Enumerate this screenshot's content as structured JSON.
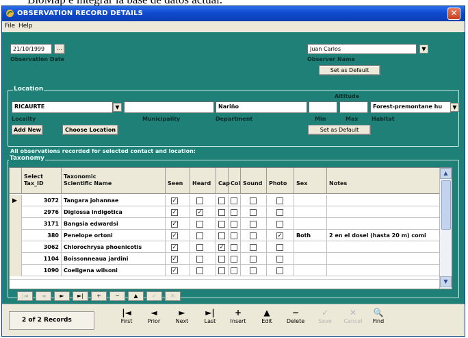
{
  "background_text": "BioMap e integrar la base de datos actual.",
  "window": {
    "title": "OBSERVATION RECORD DETAILS",
    "close_glyph": "✕"
  },
  "menu": [
    "File",
    "Help"
  ],
  "observation": {
    "date_value": "21/10/1999",
    "date_btn": "...",
    "date_label": "Observation Date",
    "observer_value": "Juan Carlos",
    "observer_label": "Observer Name",
    "set_default": "Set as Default"
  },
  "location": {
    "group_title": "Location",
    "locality_value": "RICAURTE",
    "locality_label": "Locality",
    "municipality_value": "",
    "municipality_label": "Municipality",
    "department_value": "Nariño",
    "department_label": "Department",
    "altitude_label": "Altitude",
    "min_label": "Min",
    "max_label": "Max",
    "min_value": "",
    "max_value": "",
    "habitat_value": "Forest-premontane hu",
    "habitat_label": "Habitat",
    "add_new": "Add New",
    "choose_location": "Choose Location",
    "set_default": "Set as Default"
  },
  "taxonomy": {
    "subtitle": "All observations recorded for selected contact and location:",
    "group_title": "Taxonomy",
    "headers": {
      "select": "Select",
      "tax_id": "Tax_ID",
      "taxonomic": "Taxonomic",
      "scientific": "Scientific Name",
      "seen": "Seen",
      "heard": "Heard",
      "cap": "Cap",
      "col": "Col",
      "sound": "Sound",
      "photo": "Photo",
      "sex": "Sex",
      "notes": "Notes"
    },
    "rows": [
      {
        "tax_id": "3072",
        "name": "Tangara johannae",
        "seen": true,
        "heard": false,
        "cap": false,
        "col": false,
        "sound": false,
        "photo": false,
        "sex": "",
        "notes": ""
      },
      {
        "tax_id": "2976",
        "name": "Diglossa indigotica",
        "seen": true,
        "heard": true,
        "cap": false,
        "col": false,
        "sound": false,
        "photo": false,
        "sex": "",
        "notes": ""
      },
      {
        "tax_id": "3171",
        "name": "Bangsia edwardsi",
        "seen": true,
        "heard": false,
        "cap": false,
        "col": false,
        "sound": false,
        "photo": false,
        "sex": "",
        "notes": ""
      },
      {
        "tax_id": "380",
        "name": "Penelope ortoni",
        "seen": true,
        "heard": false,
        "cap": false,
        "col": false,
        "sound": false,
        "photo": true,
        "sex": "Both",
        "notes": "2 en el dosel (hasta 20 m) comi"
      },
      {
        "tax_id": "3062",
        "name": "Chlorochrysa phoenicotis",
        "seen": true,
        "heard": false,
        "cap": true,
        "col": false,
        "sound": false,
        "photo": false,
        "sex": "",
        "notes": ""
      },
      {
        "tax_id": "1104",
        "name": "Boissonneaua jardini",
        "seen": true,
        "heard": false,
        "cap": false,
        "col": false,
        "sound": false,
        "photo": false,
        "sex": "",
        "notes": ""
      },
      {
        "tax_id": "1090",
        "name": "Coeligena wilsoni",
        "seen": true,
        "heard": false,
        "cap": false,
        "col": false,
        "sound": false,
        "photo": false,
        "sex": "",
        "notes": ""
      }
    ],
    "nav_glyphs": [
      "|◄",
      "◄",
      "►",
      "►|",
      "+",
      "−",
      "▲",
      "✓",
      "✕"
    ]
  },
  "footer": {
    "record_status": "2 of 2 Records",
    "buttons": [
      {
        "label": "First",
        "glyph": "|◄",
        "enabled": true
      },
      {
        "label": "Prior",
        "glyph": "◄",
        "enabled": true
      },
      {
        "label": "Next",
        "glyph": "►",
        "enabled": true
      },
      {
        "label": "Last",
        "glyph": "►|",
        "enabled": true
      },
      {
        "label": "Insert",
        "glyph": "+",
        "enabled": true
      },
      {
        "label": "Edit",
        "glyph": "▲",
        "enabled": true
      },
      {
        "label": "Delete",
        "glyph": "−",
        "enabled": true
      },
      {
        "label": "Save",
        "glyph": "✓",
        "enabled": false
      },
      {
        "label": "Cancel",
        "glyph": "✕",
        "enabled": false
      },
      {
        "label": "Find",
        "glyph": "🔍",
        "enabled": true
      }
    ]
  }
}
